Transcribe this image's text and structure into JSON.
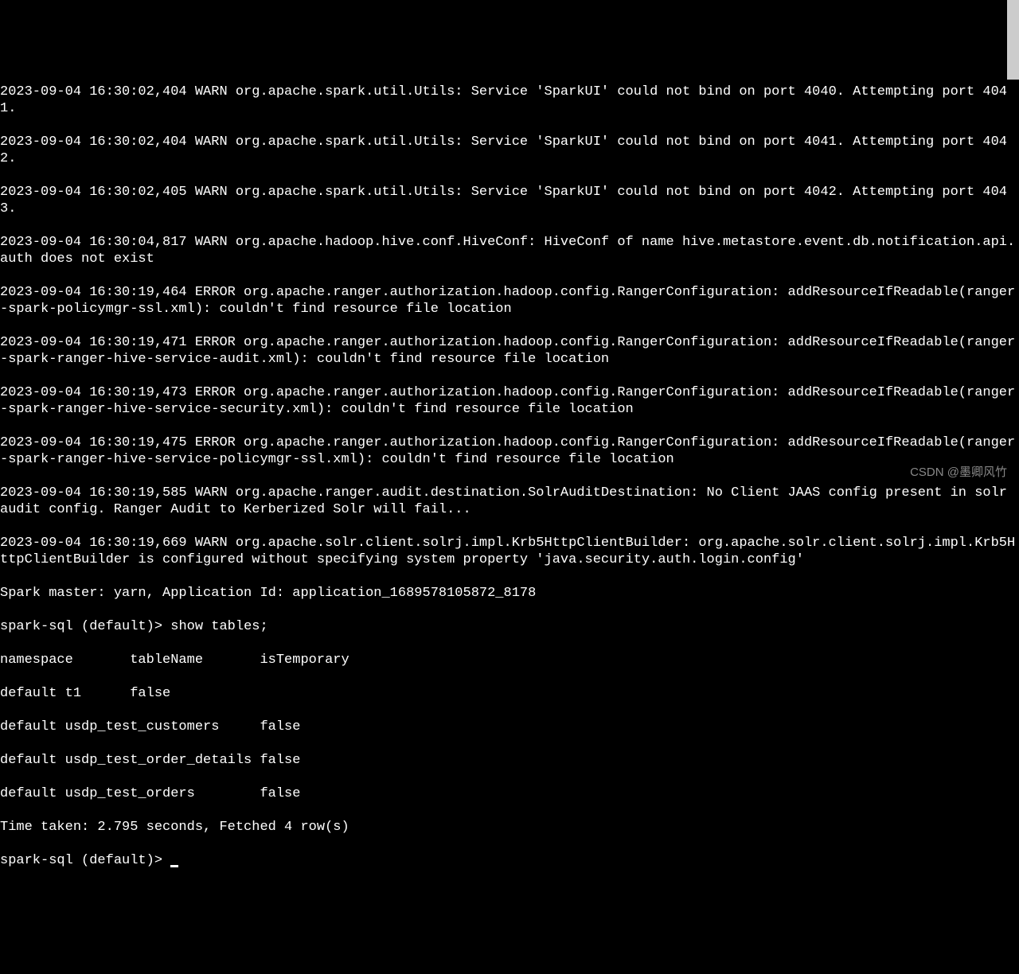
{
  "log_lines": [
    "2023-09-04 16:30:02,404 WARN org.apache.spark.util.Utils: Service 'SparkUI' could not bind on port 4040. Attempting port 4041.",
    "2023-09-04 16:30:02,404 WARN org.apache.spark.util.Utils: Service 'SparkUI' could not bind on port 4041. Attempting port 4042.",
    "2023-09-04 16:30:02,405 WARN org.apache.spark.util.Utils: Service 'SparkUI' could not bind on port 4042. Attempting port 4043.",
    "2023-09-04 16:30:04,817 WARN org.apache.hadoop.hive.conf.HiveConf: HiveConf of name hive.metastore.event.db.notification.api.auth does not exist",
    "2023-09-04 16:30:19,464 ERROR org.apache.ranger.authorization.hadoop.config.RangerConfiguration: addResourceIfReadable(ranger-spark-policymgr-ssl.xml): couldn't find resource file location",
    "2023-09-04 16:30:19,471 ERROR org.apache.ranger.authorization.hadoop.config.RangerConfiguration: addResourceIfReadable(ranger-spark-ranger-hive-service-audit.xml): couldn't find resource file location",
    "2023-09-04 16:30:19,473 ERROR org.apache.ranger.authorization.hadoop.config.RangerConfiguration: addResourceIfReadable(ranger-spark-ranger-hive-service-security.xml): couldn't find resource file location",
    "2023-09-04 16:30:19,475 ERROR org.apache.ranger.authorization.hadoop.config.RangerConfiguration: addResourceIfReadable(ranger-spark-ranger-hive-service-policymgr-ssl.xml): couldn't find resource file location",
    "2023-09-04 16:30:19,585 WARN org.apache.ranger.audit.destination.SolrAuditDestination: No Client JAAS config present in solr audit config. Ranger Audit to Kerberized Solr will fail...",
    "2023-09-04 16:30:19,669 WARN org.apache.solr.client.solrj.impl.Krb5HttpClientBuilder: org.apache.solr.client.solrj.impl.Krb5HttpClientBuilder is configured without specifying system property 'java.security.auth.login.config'",
    "Spark master: yarn, Application Id: application_1689578105872_8178"
  ],
  "prompt1": "spark-sql (default)> ",
  "command1": "show tables;",
  "table_header": "namespace       tableName       isTemporary",
  "table_rows": [
    "default t1      false",
    "default usdp_test_customers     false",
    "default usdp_test_order_details false",
    "default usdp_test_orders        false"
  ],
  "time_taken": "Time taken: 2.795 seconds, Fetched 4 row(s)",
  "prompt2": "spark-sql (default)> ",
  "watermark": "CSDN @墨卿风竹"
}
